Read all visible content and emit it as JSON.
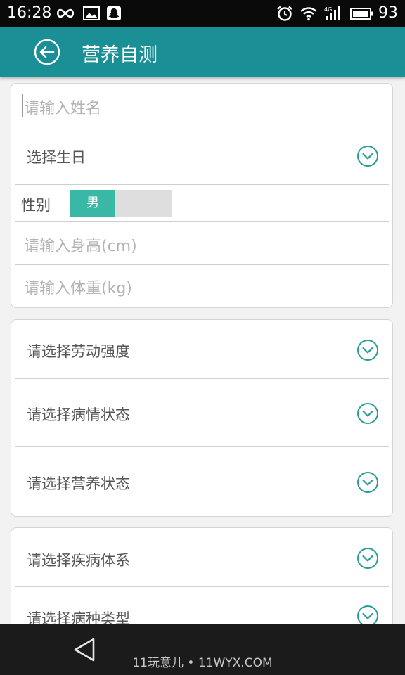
{
  "status_bar": {
    "time": "16:28",
    "battery": "93",
    "icons": [
      "infinity-icon",
      "image-icon",
      "snapchat-icon",
      "alarm-icon",
      "wifi-icon",
      "signal-4g-icon",
      "battery-icon"
    ]
  },
  "app_bar": {
    "title": "营养自测",
    "back_icon": "back-circle-icon"
  },
  "form": {
    "name_placeholder": "请输入姓名",
    "birthday_label": "选择生日",
    "gender_label": "性别",
    "gender_male": "男",
    "gender_female": "",
    "gender_selected": "男",
    "height_placeholder": "请输入身高(cm)",
    "weight_placeholder": "请输入体重(kg)"
  },
  "status_card": {
    "labor": "请选择劳动强度",
    "disease_state": "请选择病情状态",
    "nutrition_state": "请选择营养状态"
  },
  "disease_card": {
    "disease_system": "请选择疾病体系",
    "disease_type": "请选择病种类型"
  },
  "nav_bar": {
    "watermark": "11玩意儿 • 11WYX.COM"
  },
  "colors": {
    "app_bar": "#1a8f95",
    "accent": "#3ab8a6",
    "chevron": "#2a9d92"
  }
}
